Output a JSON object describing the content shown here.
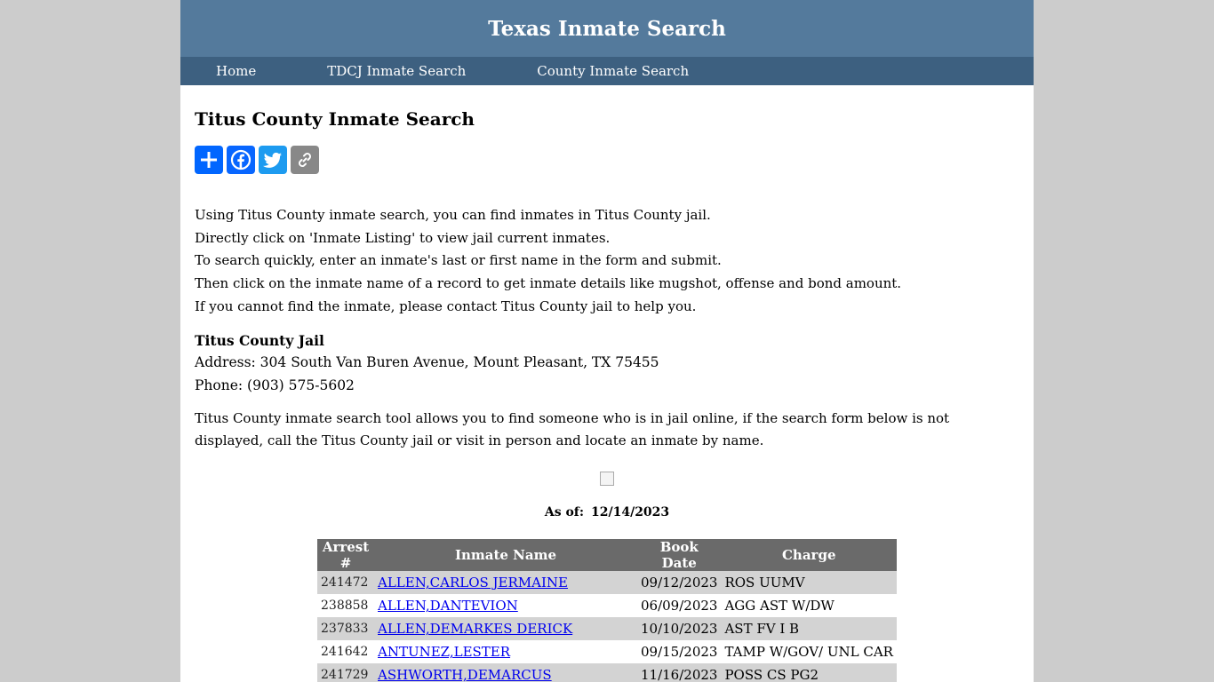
{
  "header": {
    "title": "Texas Inmate Search"
  },
  "nav": {
    "home": "Home",
    "tdcj": "TDCJ Inmate Search",
    "county": "County Inmate Search"
  },
  "page": {
    "title": "Titus County Inmate Search"
  },
  "share": {
    "icons": [
      "share-plus-icon",
      "facebook-icon",
      "twitter-icon",
      "copy-link-icon"
    ]
  },
  "intro": {
    "lines": [
      "Using Titus County inmate search, you can find inmates in Titus County jail.",
      "Directly click on 'Inmate Listing' to view jail current inmates.",
      "To search quickly, enter an inmate's last or first name in the form and submit.",
      "Then click on the inmate name of a record to get inmate details like mugshot, offense and bond amount.",
      "If you cannot find the inmate, please contact Titus County jail to help you."
    ]
  },
  "jail": {
    "name": "Titus County Jail",
    "address": "Address: 304 South Van Buren Avenue, Mount Pleasant, TX 75455",
    "phone": "Phone: (903) 575-5602"
  },
  "tool_text": "Titus County inmate search tool allows you to find someone who is in jail online, if the search form below is not displayed, call the Titus County jail or visit in person and locate an inmate by name.",
  "asof": {
    "label": "As of:",
    "date": "12/14/2023"
  },
  "table": {
    "headers": [
      "Arrest #",
      "Inmate Name",
      "Book Date",
      "Charge"
    ],
    "rows": [
      {
        "arrest": "241472",
        "name": "ALLEN,CARLOS JERMAINE",
        "date": "09/12/2023",
        "charge": "ROS UUMV"
      },
      {
        "arrest": "238858",
        "name": "ALLEN,DANTEVION",
        "date": "06/09/2023",
        "charge": "AGG AST W/DW"
      },
      {
        "arrest": "237833",
        "name": "ALLEN,DEMARKES DERICK",
        "date": "10/10/2023",
        "charge": "AST FV I B"
      },
      {
        "arrest": "241642",
        "name": "ANTUNEZ,LESTER",
        "date": "09/15/2023",
        "charge": "TAMP W/GOV/ UNL CAR"
      },
      {
        "arrest": "241729",
        "name": "ASHWORTH,DEMARCUS",
        "date": "11/16/2023",
        "charge": "POSS CS PG2"
      }
    ]
  },
  "colors": {
    "header_bg": "#547a9c",
    "nav_bg": "#3d6080",
    "table_header_bg": "#6a6a6a",
    "row_alt_bg": "#d3d3d3",
    "link": "#0000ee"
  }
}
